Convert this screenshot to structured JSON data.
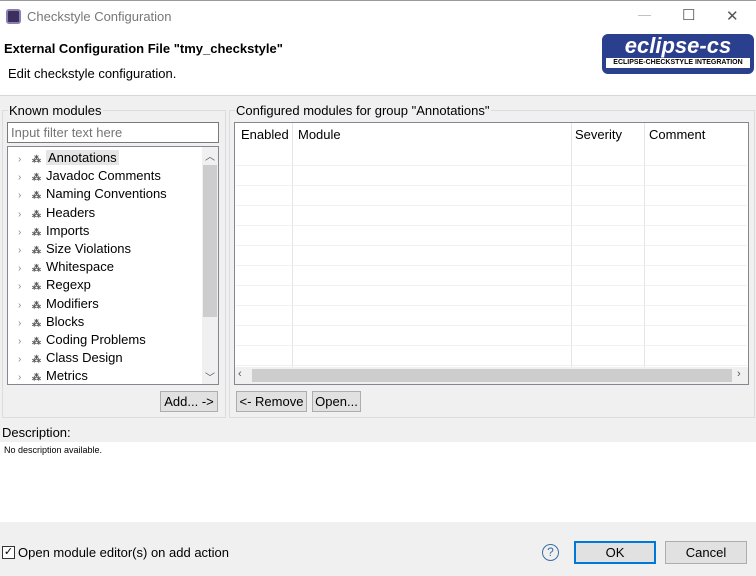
{
  "window": {
    "title": "Checkstyle Configuration",
    "minimize": "—",
    "maximize": "☐",
    "close": "✕"
  },
  "header": {
    "title": "External Configuration File \"tmy_checkstyle\"",
    "subtitle": "Edit checkstyle configuration.",
    "logo_text": "eclipse-cs",
    "logo_sub": "ECLIPSE-CHECKSTYLE INTEGRATION"
  },
  "known": {
    "label": "Known modules",
    "filter_placeholder": "Input filter text here",
    "items": [
      "Annotations",
      "Javadoc Comments",
      "Naming Conventions",
      "Headers",
      "Imports",
      "Size Violations",
      "Whitespace",
      "Regexp",
      "Modifiers",
      "Blocks",
      "Coding Problems",
      "Class Design",
      "Metrics"
    ],
    "selected": "Annotations",
    "add_label": "Add... ->"
  },
  "configured": {
    "label": "Configured modules for group \"Annotations\"",
    "columns": [
      "Enabled",
      "Module",
      "Severity",
      "Comment"
    ],
    "remove_label": "<- Remove",
    "open_label": "Open..."
  },
  "description": {
    "label": "Description:",
    "text": "No description available."
  },
  "footer": {
    "checkbox_label": "Open module editor(s) on add action",
    "checked": true,
    "help": "?",
    "ok": "OK",
    "cancel": "Cancel"
  }
}
